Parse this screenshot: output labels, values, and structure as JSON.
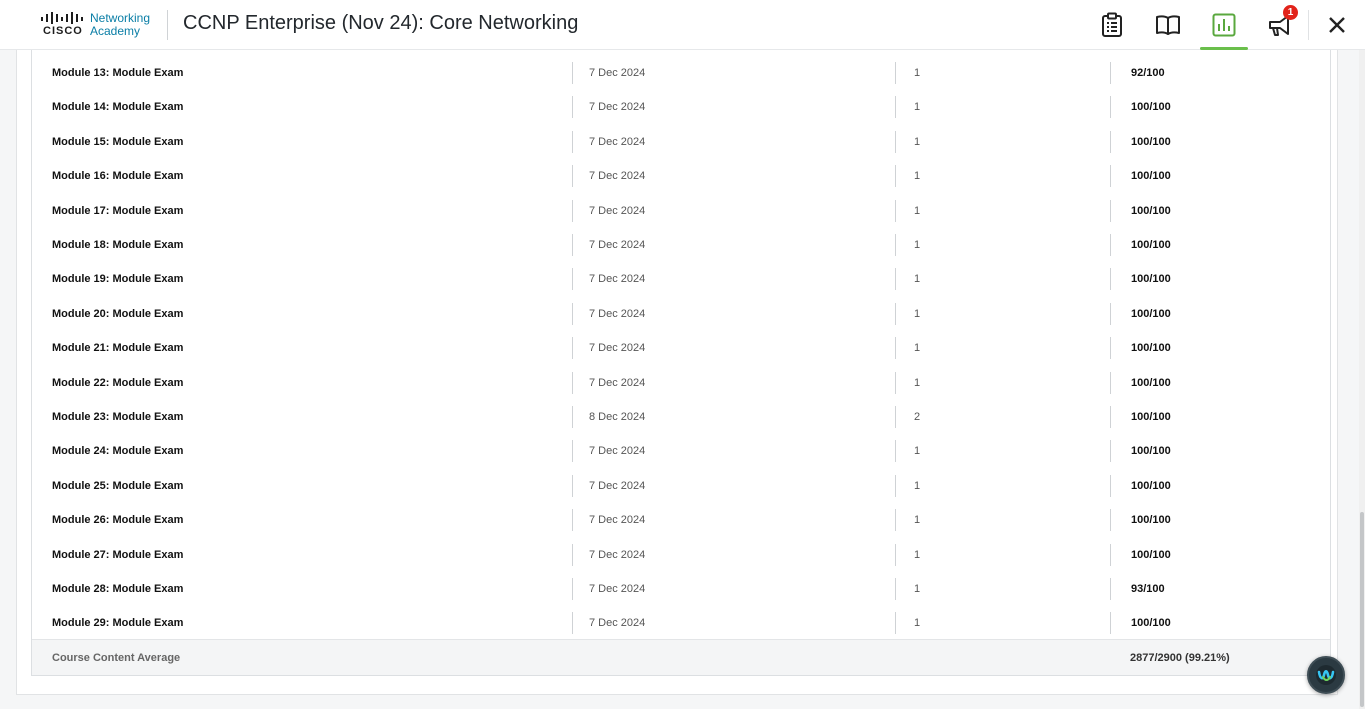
{
  "header": {
    "logo": {
      "brand": "CISCO",
      "line1": "Networking",
      "line2": "Academy"
    },
    "course_title": "CCNP Enterprise (Nov 24): Core Networking",
    "toolbar": {
      "items": [
        {
          "icon": "clipboard-icon"
        },
        {
          "icon": "book-icon"
        },
        {
          "icon": "bar-chart-icon",
          "active": true
        },
        {
          "icon": "megaphone-icon",
          "badge": "1"
        },
        {
          "icon": "close-icon"
        }
      ]
    },
    "accent_color": "#6abf4b",
    "badge_color": "#e2231a"
  },
  "grades": {
    "rows": [
      {
        "name": "Module 13: Module Exam",
        "date": "7 Dec 2024",
        "attempts": "1",
        "score": "92/100"
      },
      {
        "name": "Module 14: Module Exam",
        "date": "7 Dec 2024",
        "attempts": "1",
        "score": "100/100"
      },
      {
        "name": "Module 15: Module Exam",
        "date": "7 Dec 2024",
        "attempts": "1",
        "score": "100/100"
      },
      {
        "name": "Module 16: Module Exam",
        "date": "7 Dec 2024",
        "attempts": "1",
        "score": "100/100"
      },
      {
        "name": "Module 17: Module Exam",
        "date": "7 Dec 2024",
        "attempts": "1",
        "score": "100/100"
      },
      {
        "name": "Module 18: Module Exam",
        "date": "7 Dec 2024",
        "attempts": "1",
        "score": "100/100"
      },
      {
        "name": "Module 19: Module Exam",
        "date": "7 Dec 2024",
        "attempts": "1",
        "score": "100/100"
      },
      {
        "name": "Module 20: Module Exam",
        "date": "7 Dec 2024",
        "attempts": "1",
        "score": "100/100"
      },
      {
        "name": "Module 21: Module Exam",
        "date": "7 Dec 2024",
        "attempts": "1",
        "score": "100/100"
      },
      {
        "name": "Module 22: Module Exam",
        "date": "7 Dec 2024",
        "attempts": "1",
        "score": "100/100"
      },
      {
        "name": "Module 23: Module Exam",
        "date": "8 Dec 2024",
        "attempts": "2",
        "score": "100/100"
      },
      {
        "name": "Module 24: Module Exam",
        "date": "7 Dec 2024",
        "attempts": "1",
        "score": "100/100"
      },
      {
        "name": "Module 25: Module Exam",
        "date": "7 Dec 2024",
        "attempts": "1",
        "score": "100/100"
      },
      {
        "name": "Module 26: Module Exam",
        "date": "7 Dec 2024",
        "attempts": "1",
        "score": "100/100"
      },
      {
        "name": "Module 27: Module Exam",
        "date": "7 Dec 2024",
        "attempts": "1",
        "score": "100/100"
      },
      {
        "name": "Module 28: Module Exam",
        "date": "7 Dec 2024",
        "attempts": "1",
        "score": "93/100"
      },
      {
        "name": "Module 29: Module Exam",
        "date": "7 Dec 2024",
        "attempts": "1",
        "score": "100/100"
      }
    ],
    "average": {
      "label": "Course Content Average",
      "value": "2877/2900 (99.21%)"
    }
  },
  "floating_button": {
    "icon": "webex-icon"
  }
}
